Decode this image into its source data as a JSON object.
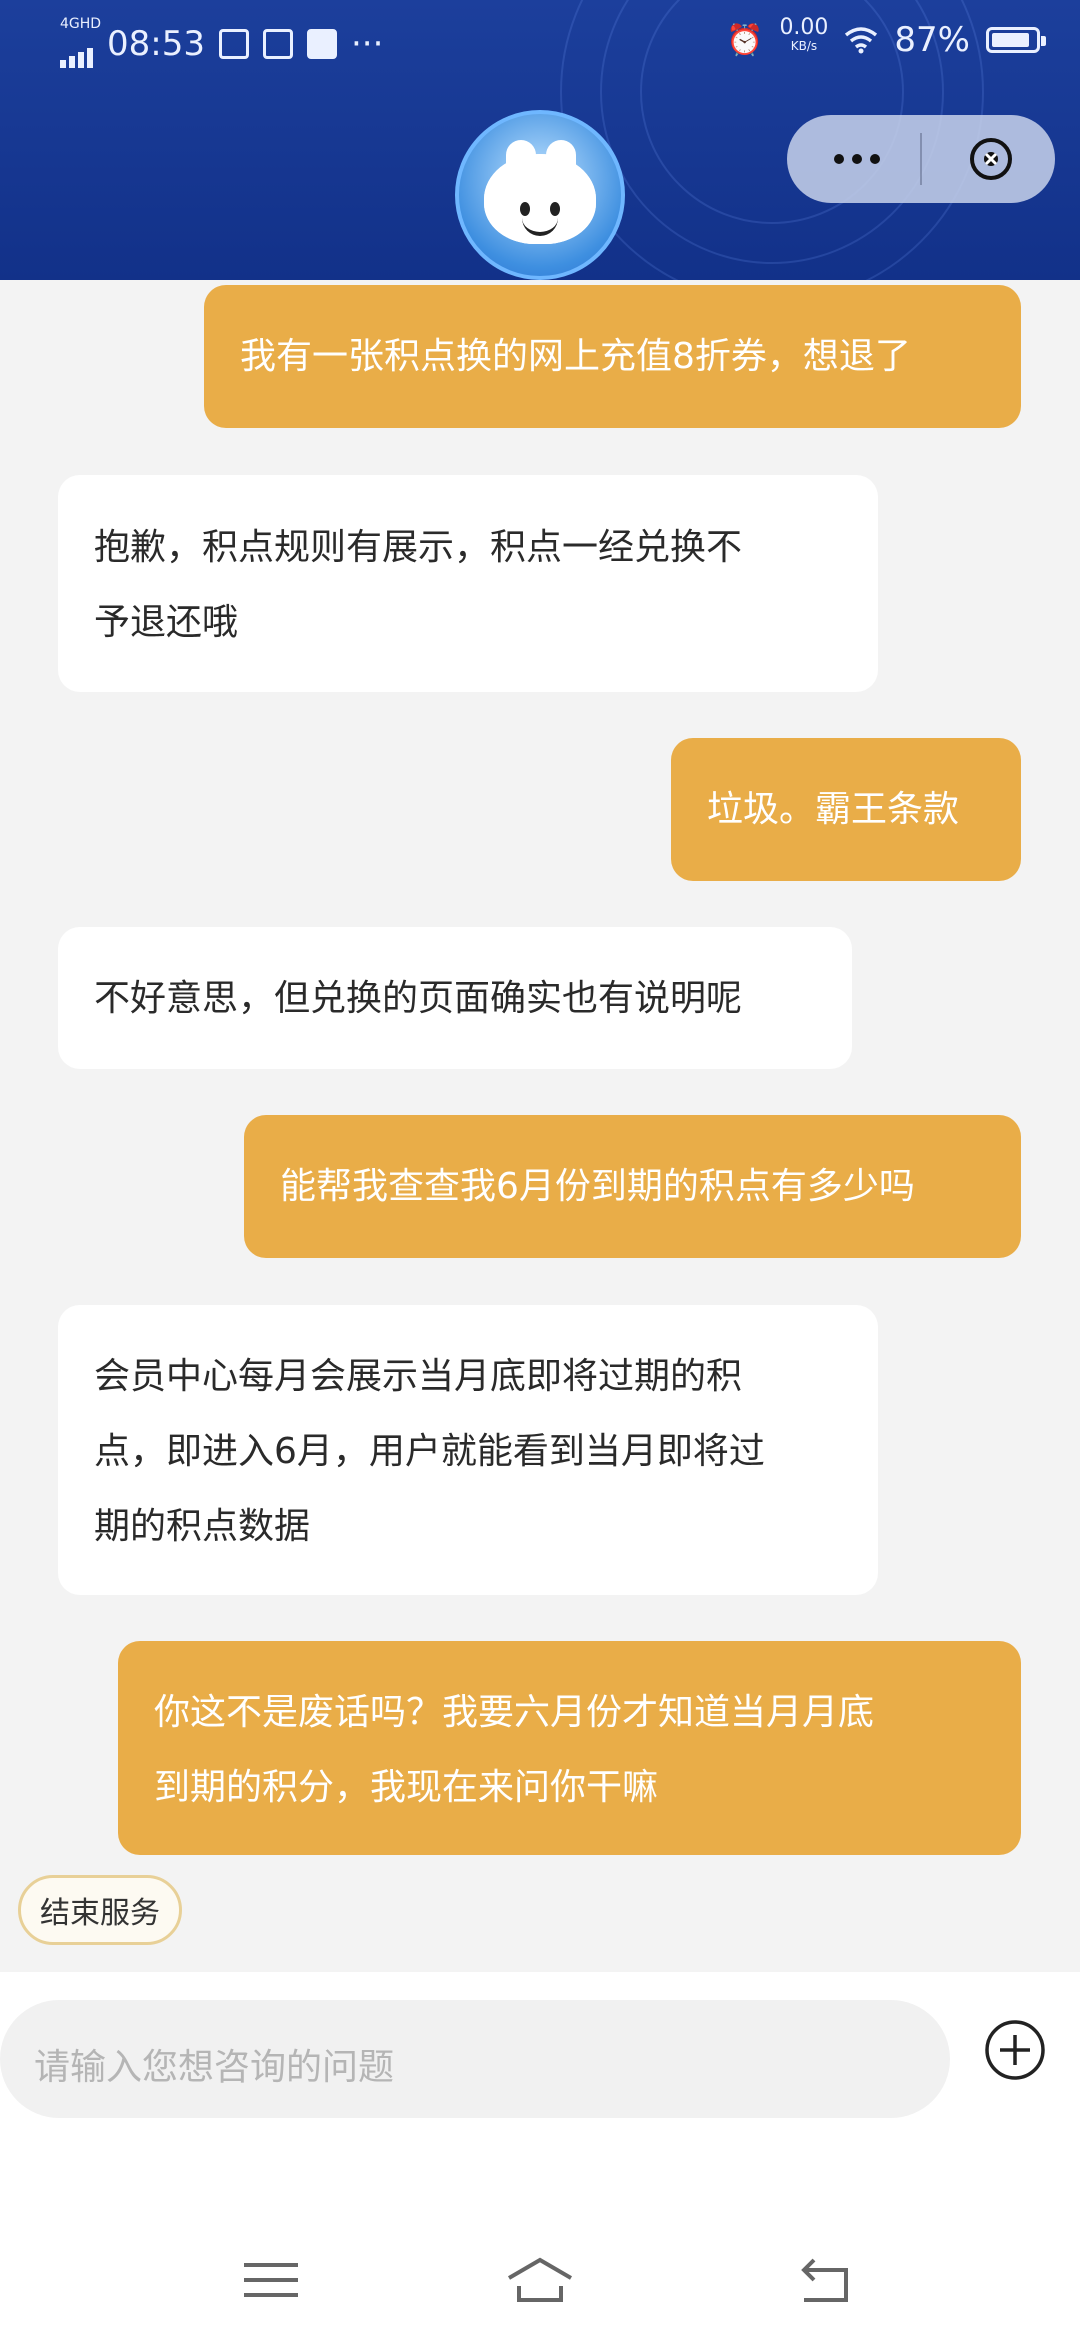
{
  "status_bar": {
    "network": "4GHD",
    "time": "08:53",
    "speed_value": "0.00",
    "speed_unit": "KB/s",
    "battery": "87%",
    "battery_level": 0.87
  },
  "header": {
    "avatar_icon": "bunny-mascot",
    "more_icon": "more-dots-icon",
    "close_icon": "close-circle-icon"
  },
  "messages": [
    {
      "role": "user",
      "lines": [
        "我有一张积点换的网上充值8折券，想退了"
      ]
    },
    {
      "role": "bot",
      "lines": [
        "抱歉，积点规则有展示，积点一经兑换不",
        "予退还哦"
      ]
    },
    {
      "role": "user",
      "lines": [
        "垃圾。霸王条款"
      ]
    },
    {
      "role": "bot",
      "lines": [
        "不好意思，但兑换的页面确实也有说明呢"
      ]
    },
    {
      "role": "user",
      "lines": [
        "能帮我查查我6月份到期的积点有多少吗"
      ]
    },
    {
      "role": "bot",
      "lines": [
        "会员中心每月会展示当月底即将过期的积",
        "点，即进入6月，用户就能看到当月即将过",
        "期的积点数据"
      ]
    },
    {
      "role": "user",
      "lines": [
        "你这不是废话吗？我要六月份才知道当月月底",
        "到期的积分，我现在来问你干嘛"
      ]
    }
  ],
  "end_service_label": "结束服务",
  "input": {
    "placeholder": "请输入您想咨询的问题"
  },
  "colors": {
    "header": "#1c3f9c",
    "user_bubble": "#e9ad48",
    "bot_bubble": "#ffffff",
    "background": "#f3f3f3"
  },
  "nav": [
    "menu-icon",
    "home-icon",
    "back-icon"
  ]
}
